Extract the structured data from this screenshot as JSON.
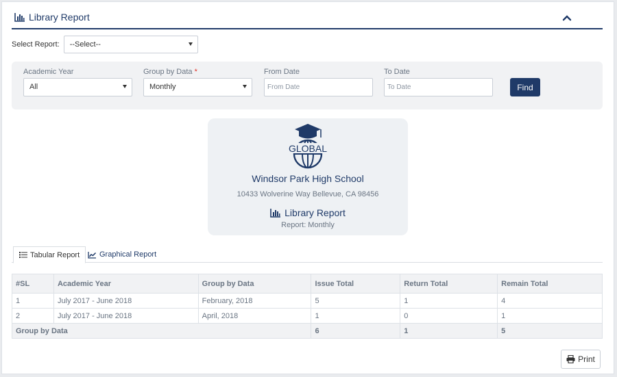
{
  "header": {
    "title": "Library Report"
  },
  "report_select": {
    "label": "Select Report:",
    "value": "--Select--"
  },
  "filters": {
    "academic_year": {
      "label": "Academic Year",
      "value": "All"
    },
    "group_by": {
      "label": "Group by Data",
      "required_mark": "*",
      "value": "Monthly"
    },
    "from_date": {
      "label": "From Date",
      "placeholder": "From Date"
    },
    "to_date": {
      "label": "To Date",
      "placeholder": "To Date"
    },
    "find_label": "Find"
  },
  "school": {
    "logo_text": "GLOBAL",
    "name": "Windsor Park High School",
    "address": "10433 Wolverine Way Bellevue, CA 98456",
    "report_title": "Library Report",
    "report_sub": "Report: Monthly"
  },
  "tabs": [
    {
      "label": "Tabular Report",
      "icon": "list-icon"
    },
    {
      "label": "Graphical Report",
      "icon": "line-chart-icon"
    }
  ],
  "table": {
    "headers": [
      "#SL",
      "Academic Year",
      "Group by Data",
      "Issue Total",
      "Return Total",
      "Remain Total"
    ],
    "rows": [
      [
        "1",
        "July 2017 - June 2018",
        "February, 2018",
        "5",
        "1",
        "4"
      ],
      [
        "2",
        "July 2017 - June 2018",
        "April, 2018",
        "1",
        "0",
        "1"
      ]
    ],
    "footer": {
      "label": "Group by Data",
      "issue": "6",
      "return": "1",
      "remain": "5"
    }
  },
  "print_label": "Print",
  "colors": {
    "brand": "#1f3a68",
    "muted": "#6a7583",
    "panel_bg": "#f1f2f4"
  }
}
